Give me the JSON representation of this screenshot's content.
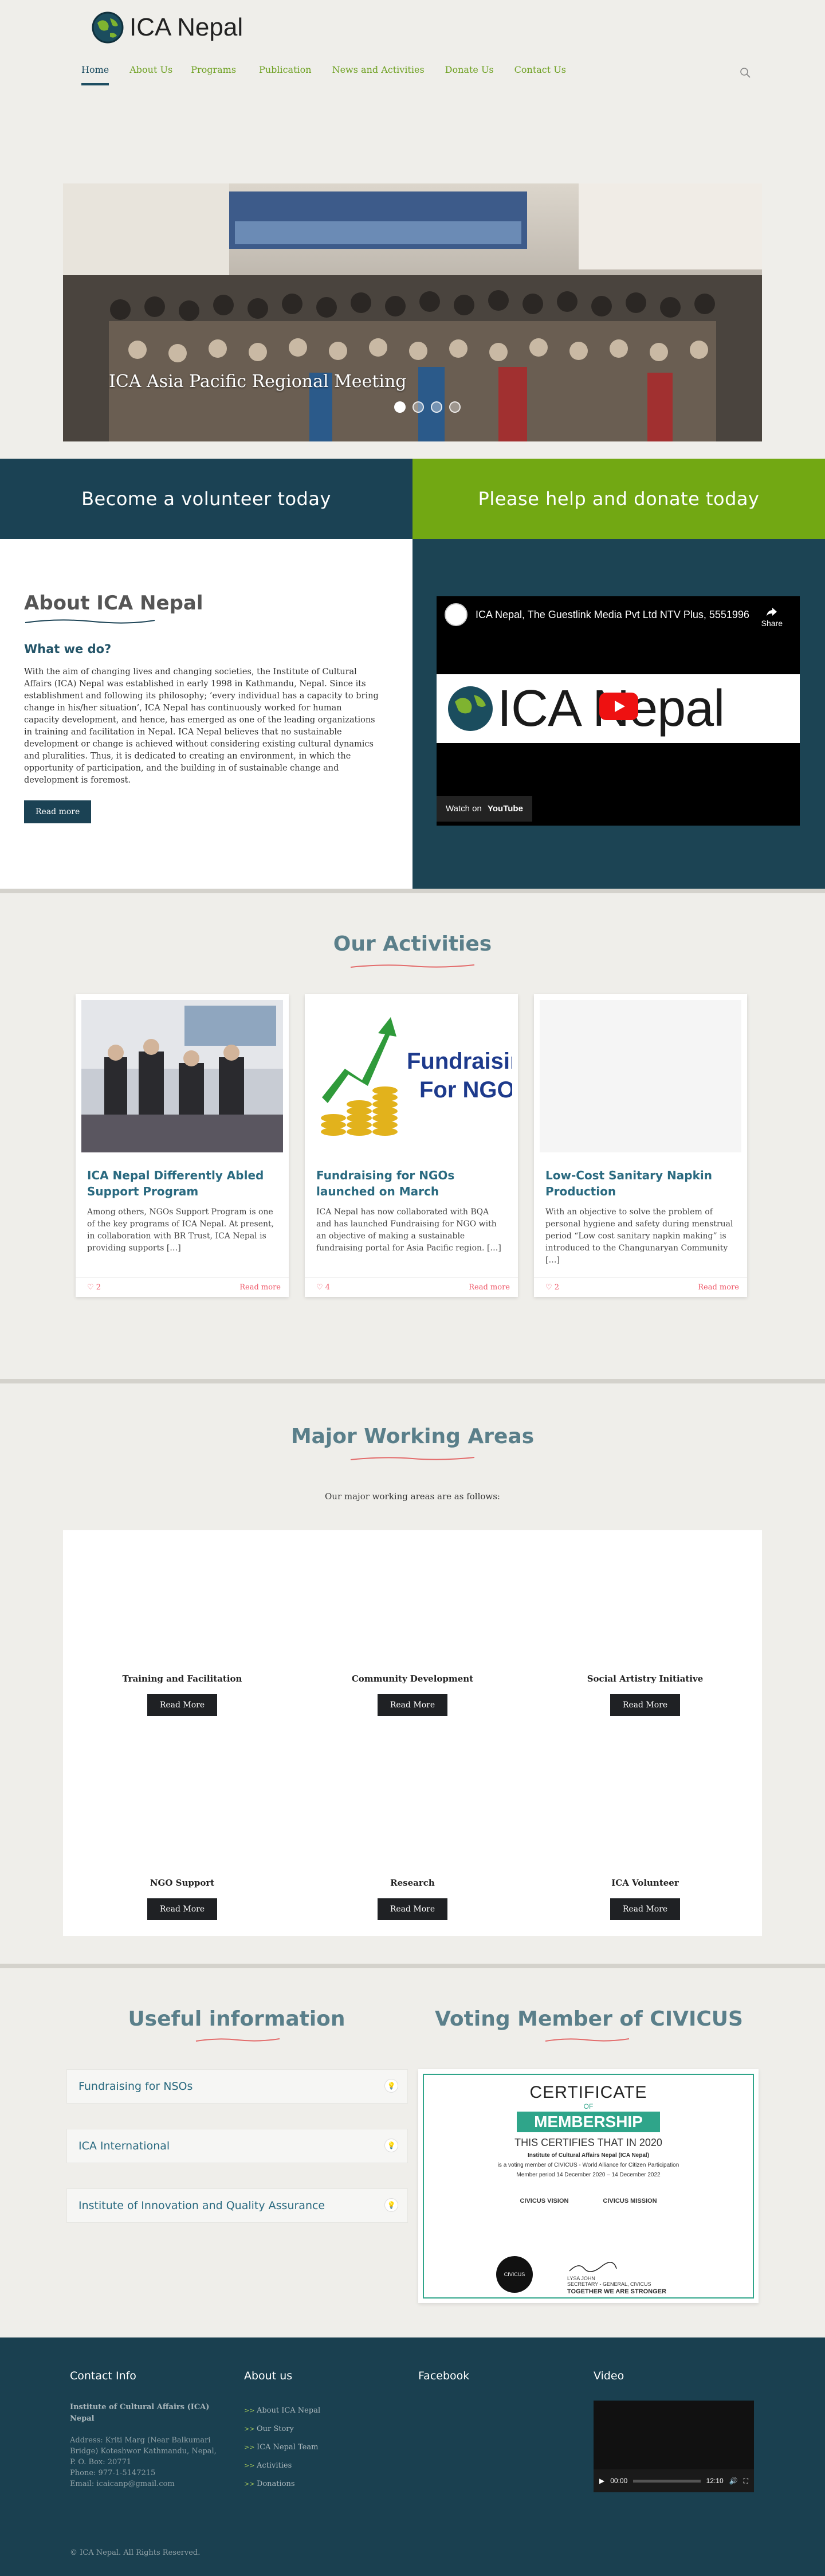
{
  "site": {
    "name": "ICA Nepal"
  },
  "nav": {
    "items": [
      {
        "label": "Home"
      },
      {
        "label": "About Us"
      },
      {
        "label": "Programs"
      },
      {
        "label": "Publication"
      },
      {
        "label": "News and Activities"
      },
      {
        "label": "Donate Us"
      },
      {
        "label": "Contact Us"
      }
    ],
    "active": "Home"
  },
  "slider": {
    "caption": "ICA Asia Pacific Regional Meeting",
    "slide_count": 4,
    "active_slide": 1
  },
  "cta": {
    "volunteer": "Become a volunteer today",
    "donate": "Please help and donate today"
  },
  "about": {
    "title": "About ICA Nepal",
    "subtitle": "What we do?",
    "text": "With the aim of changing lives and changing societies, the Institute of Cultural Affairs (ICA) Nepal was established in early 1998 in Kathmandu, Nepal. Since its establishment and following its philosophy; ‘every individual has a capacity to bring change in his/her situation’, ICA Nepal has continuously worked for human capacity development, and hence, has emerged as one of the leading organizations in training and facilitation in Nepal. ICA Nepal believes that no sustainable development or change is achieved without considering existing cultural dynamics and pluralities. Thus, it is dedicated to creating an environment, in which the opportunity of participation, and the building in of sustainable change and development is foremost.",
    "button": "Read more",
    "video": {
      "title": "ICA Nepal, The Guestlink Media Pvt Ltd NTV Plus, 5551996",
      "share": "Share",
      "banner": "ICA Nepal",
      "watch_on": "Watch on",
      "platform": "YouTube"
    }
  },
  "activities": {
    "title": "Our Activities",
    "cards": [
      {
        "title": "ICA Nepal Differently Abled Support Program",
        "text": "Among others, NGOs Support Program is one of the key programs of ICA Nepal. At present, in collaboration with BR Trust, ICA Nepal is providing supports […]",
        "likes": "2",
        "more": "Read more"
      },
      {
        "title": "Fundraising for NGOs launched on March",
        "text": "ICA Nepal has now collaborated with BQA and has launched Fundraising for NGO with an objective of making a sustainable fundraising portal for Asia Pacific region. […]",
        "likes": "4",
        "more": "Read more",
        "image_text": [
          "Fundraising",
          "For NGOs"
        ]
      },
      {
        "title": "Low-Cost Sanitary Napkin Production",
        "text": "With an objective to solve the problem of personal hygiene and safety during menstrual period “Low cost sanitary napkin making” is introduced to the Changunaryan Community […]",
        "likes": "2",
        "more": "Read more"
      }
    ]
  },
  "working": {
    "title": "Major Working Areas",
    "subtitle": "Our major working areas are as follows:",
    "button": "Read More",
    "items": [
      {
        "name": "Training and Facilitation"
      },
      {
        "name": "Community Development"
      },
      {
        "name": "Social Artistry Initiative"
      },
      {
        "name": "NGO Support"
      },
      {
        "name": "Research"
      },
      {
        "name": "ICA Volunteer"
      }
    ]
  },
  "useful": {
    "title": "Useful information",
    "items": [
      {
        "label": "Fundraising for NSOs"
      },
      {
        "label": "ICA International"
      },
      {
        "label": "Institute of Innovation and Quality Assurance"
      }
    ]
  },
  "civicus": {
    "title": "Voting Member of CIVICUS",
    "cert": {
      "heading": "CERTIFICATE",
      "of": "OF",
      "ribbon": "MEMBERSHIP",
      "line1": "THIS CERTIFIES THAT IN 2020",
      "org": "Institute of Cultural Affairs Nepal (ICA Nepal)",
      "line2": "is a voting member of CIVICUS - World Alliance for Citizen Participation",
      "period": "Member period 14 December 2020 – 14 December 2022",
      "vision_title": "CIVICUS VISION",
      "mission_title": "CIVICUS MISSION",
      "signer": "LYSA JOHN",
      "signer_role": "SECRETARY - GENERAL, CIVICUS",
      "tagline": "TOGETHER WE ARE STRONGER",
      "seal": "CIVICUS"
    }
  },
  "footer": {
    "contact": {
      "heading": "Contact Info",
      "org": "Institute of Cultural Affairs (ICA) Nepal",
      "address": "Address: Kriti Marg (Near Balkumari Bridge) Koteshwor Kathmandu, Nepal, P. O. Box: 20771",
      "phone": "Phone: 977-1-5147215",
      "email": "Email: icaicanp@gmail.com"
    },
    "about": {
      "heading": "About us",
      "links": [
        "About ICA Nepal",
        "Our Story",
        "ICA Nepal Team",
        "Activities",
        "Donations"
      ]
    },
    "facebook": {
      "heading": "Facebook"
    },
    "video": {
      "heading": "Video",
      "time_start": "00:00",
      "time_end": "12:10"
    },
    "copyright": "© ICA Nepal. All Rights Reserved."
  },
  "colors": {
    "accent_green": "#72a813",
    "dark_teal": "#1b4254",
    "link_green": "#6fa124",
    "title_blue": "#5a7f8a"
  }
}
